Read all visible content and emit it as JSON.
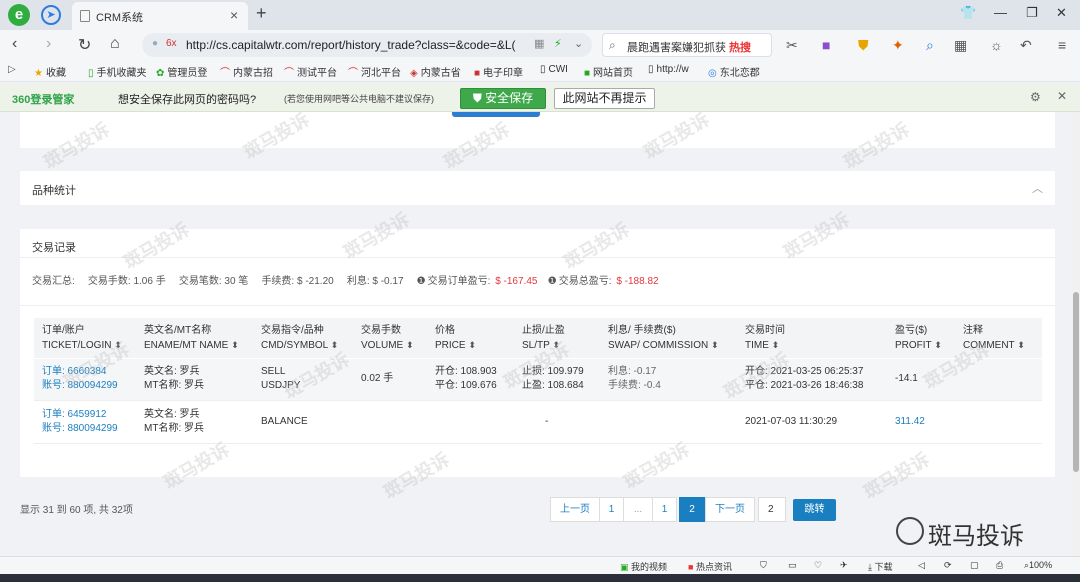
{
  "browser": {
    "logo": "e",
    "tab_title": "CRM系统",
    "url": "http://cs.capitalwtr.com/report/history_trade?class=&code=&L(",
    "search_text": "晨跑遇害案嫌犯抓获",
    "search_badge": "热搜"
  },
  "bookmarks": [
    "收藏",
    "手机收藏夹",
    "管理员登",
    "内蒙古招",
    "测试平台",
    "河北平台",
    "内蒙古省",
    "电子印章",
    "CWI",
    "网站首页",
    "内蒙古省",
    "http://w",
    "东北恋郡"
  ],
  "savebar": {
    "logo": "360登录管家",
    "question": "想安全保存此网页的密码吗?",
    "note": "(若您使用网吧等公共电脑不建议保存)",
    "save_label": "安全保存",
    "nosave_label": "此网站不再提示"
  },
  "sections": {
    "variety_title": "品种统计",
    "trade_title": "交易记录"
  },
  "summary": {
    "label": "交易汇总:",
    "lots_label": "交易手数: 1.06 手",
    "count_label": "交易笔数: 30 笔",
    "fee_label": "手续费: $ -21.20",
    "interest_label": "利息: $ -0.17",
    "order_profit_label": "交易订单盈亏:",
    "order_profit_value": "$ -167.45",
    "total_profit_label": "交易总盈亏:",
    "total_profit_value": "$ -188.82"
  },
  "table": {
    "headers": [
      {
        "cn": "订单/账户",
        "en": "TICKET/LOGIN"
      },
      {
        "cn": "英文名/MT名称",
        "en": "ENAME/MT NAME"
      },
      {
        "cn": "交易指令/品种",
        "en": "CMD/SYMBOL"
      },
      {
        "cn": "交易手数",
        "en": "VOLUME"
      },
      {
        "cn": "价格",
        "en": "PRICE"
      },
      {
        "cn": "止损/止盈",
        "en": "SL/TP"
      },
      {
        "cn": "利息/ 手续费($)",
        "en": "SWAP/ COMMISSION"
      },
      {
        "cn": "交易时间",
        "en": "TIME"
      },
      {
        "cn": "盈亏($)",
        "en": "PROFIT"
      },
      {
        "cn": "注释",
        "en": "COMMENT"
      }
    ],
    "rows": [
      {
        "ticket": "订单: 6660384",
        "login": "账号: 880094299",
        "ename": "英文名: 罗兵",
        "mtname": "MT名称: 罗兵",
        "cmd": "SELL",
        "symbol": "USDJPY",
        "volume": "0.02 手",
        "open_price": "开仓: 108.903",
        "close_price": "平仓: 109.676",
        "sl": "止损: 109.979",
        "tp": "止盈: 108.684",
        "swap": "利息: -0.17",
        "commission": "手续费: -0.4",
        "open_time": "开仓: 2021-03-25 06:25:37",
        "close_time": "平仓: 2021-03-26 18:46:38",
        "profit": "-14.1",
        "comment": ""
      },
      {
        "ticket": "订单: 6459912",
        "login": "账号: 880094299",
        "ename": "英文名: 罗兵",
        "mtname": "MT名称: 罗兵",
        "cmd": "BALANCE",
        "sltp": "-",
        "time": "2021-07-03 11:30:29",
        "profit": "311.42",
        "comment": ""
      }
    ]
  },
  "pagination": {
    "info": "显示 31 到 60 项, 共 32项",
    "prev": "上一页",
    "pages": [
      "1",
      "...",
      "1",
      "2"
    ],
    "next": "下一页",
    "goto_value": "2",
    "goto_label": "跳转"
  },
  "watermark": "斑马投诉",
  "status": {
    "video": "我的视频",
    "news": "热点资讯",
    "download": "下载",
    "zoom": "100%"
  }
}
